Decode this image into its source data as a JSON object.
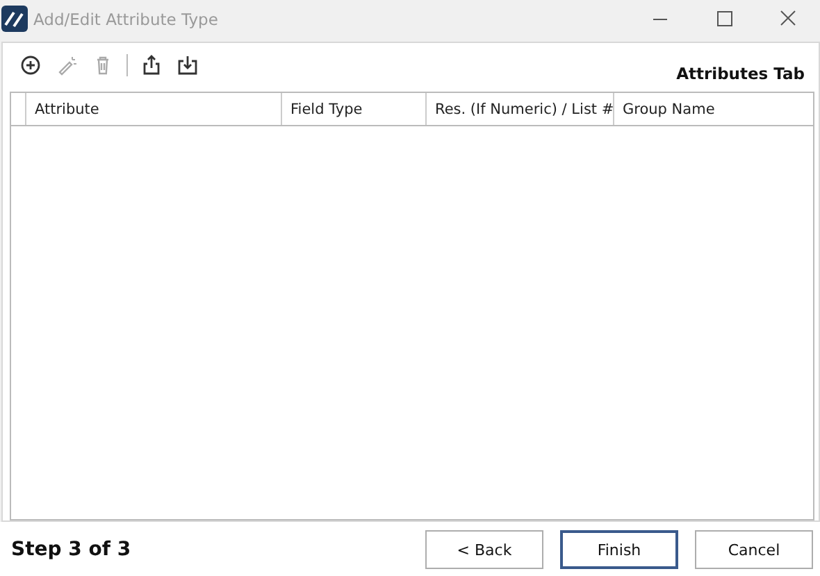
{
  "window": {
    "title": "Add/Edit Attribute Type"
  },
  "toolbar": [
    {
      "kind": "add",
      "disabled": false
    },
    {
      "kind": "wand",
      "disabled": true
    },
    {
      "kind": "trash",
      "disabled": true
    },
    {
      "kind": "separator"
    },
    {
      "kind": "export",
      "disabled": false
    },
    {
      "kind": "import",
      "disabled": false
    }
  ],
  "tab_title": "Attributes Tab",
  "table": {
    "columns": [
      "Attribute",
      "Field Type",
      "Res. (If Numeric) / List #",
      "Group Name"
    ]
  },
  "step": "Step 3 of 3",
  "buttons": [
    {
      "label": "< Back",
      "default": false
    },
    {
      "label": "Finish",
      "default": true
    },
    {
      "label": "Cancel",
      "default": false
    }
  ]
}
